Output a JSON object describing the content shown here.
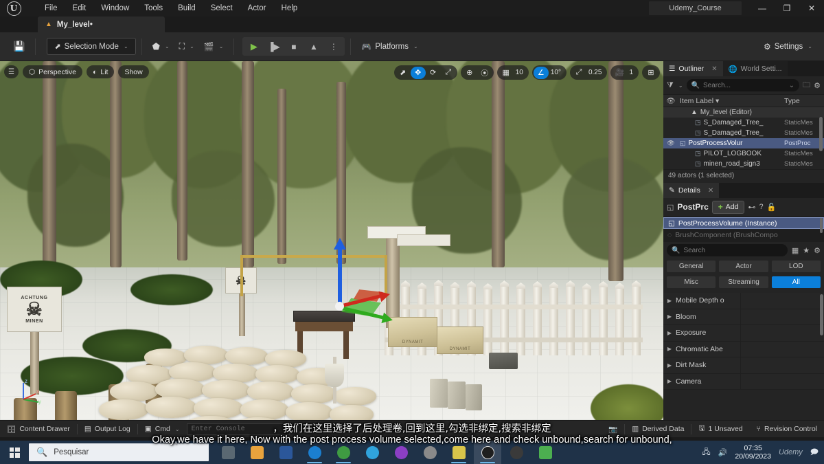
{
  "window": {
    "title": "Udemy_Course",
    "logo_text": "U",
    "minimize": "—",
    "maximize": "❐",
    "close": "✕"
  },
  "menubar": {
    "items": [
      "File",
      "Edit",
      "Window",
      "Tools",
      "Build",
      "Select",
      "Actor",
      "Help"
    ]
  },
  "level_tab": {
    "label": "My_level•",
    "icon": "level-icon"
  },
  "toolbar": {
    "save_icon": "save-icon",
    "selection_mode": "Selection Mode",
    "add_actor_icon": "add-actor-icon",
    "blueprints_icon": "blueprints-icon",
    "cinematics_icon": "cinematics-icon",
    "play": "▶",
    "skip": "▐▶",
    "stop": "■",
    "eject": "▲",
    "more": "⋮",
    "platforms": "Platforms",
    "settings": "Settings",
    "caret": "⌄"
  },
  "viewport": {
    "menu_icon": "viewport-menu-icon",
    "perspective": "Perspective",
    "lit": "Lit",
    "show": "Show",
    "tools": {
      "select": "select-tool-icon",
      "translate": "translate-tool-icon",
      "rotate": "rotate-tool-icon",
      "scale": "scale-tool-icon",
      "world_coord": "world-coordinate-icon",
      "surface_snap": "surface-snap-icon",
      "grid_snap": "grid-snap-icon",
      "grid_value": "10",
      "angle_snap": "angle-snap-icon",
      "angle_value": "10°",
      "scale_snap": "scale-snap-icon",
      "scale_value": "0.25",
      "camera_speed": "camera-speed-icon",
      "camera_value": "1",
      "layouts": "viewport-layouts-icon"
    },
    "axis": {
      "x": "x",
      "y": "y",
      "z": "z"
    },
    "scene": {
      "sign_line1": "ACHTUNG",
      "sign_line2": "MINEN",
      "crate_label": "DYNAMIT"
    }
  },
  "outliner": {
    "tab_label": "Outliner",
    "tab_icon": "outliner-icon",
    "world_settings_tab": "World Setti...",
    "world_settings_icon": "world-icon",
    "close": "✕",
    "filter_icon": "filter-icon",
    "search_placeholder": "Search...",
    "search_value": "",
    "new_folder_icon": "new-folder-icon",
    "settings_icon": "gear-icon",
    "columns": {
      "eye": "eye-icon",
      "label": "Item Label",
      "sort": "▾",
      "type": "Type"
    },
    "rows": [
      {
        "name": "My_level (Editor)",
        "type": "",
        "icon": "level-icon",
        "selected": false,
        "is_root": true
      },
      {
        "name": "S_Damaged_Tree_",
        "type": "StaticMes",
        "icon": "mesh-icon",
        "selected": false
      },
      {
        "name": "S_Damaged_Tree_",
        "type": "StaticMes",
        "icon": "mesh-icon",
        "selected": false
      },
      {
        "name": "PostProcessVolur",
        "type": "PostProc",
        "icon": "volume-icon",
        "selected": true
      },
      {
        "name": "PILOT_LOGBOOK",
        "type": "StaticMes",
        "icon": "mesh-icon",
        "selected": false
      },
      {
        "name": "minen_road_sign3",
        "type": "StaticMes",
        "icon": "mesh-icon",
        "selected": false
      }
    ],
    "status": "49 actors (1 selected)"
  },
  "details": {
    "tab_label": "Details",
    "tab_icon": "details-icon",
    "close": "✕",
    "object_name": "PostPrc",
    "object_icon": "volume-icon",
    "add_label": "Add",
    "add_plus": "+",
    "blueprint_icon": "blueprint-icon",
    "help_icon": "help-icon",
    "lock_icon": "lock-icon",
    "components": [
      {
        "label": "PostProcessVolume (Instance)",
        "icon": "volume-icon",
        "selected": true
      },
      {
        "label": "BrushComponent (BrushCompo",
        "icon": "brush-icon",
        "selected": false
      }
    ],
    "search_placeholder": "Search",
    "search_value": "",
    "grid_view_icon": "grid-view-icon",
    "favorites_icon": "star-icon",
    "settings_icon": "gear-icon",
    "filters": [
      {
        "label": "General",
        "active": false
      },
      {
        "label": "Actor",
        "active": false
      },
      {
        "label": "LOD",
        "active": false
      },
      {
        "label": "Misc",
        "active": false
      },
      {
        "label": "Streaming",
        "active": false
      },
      {
        "label": "All",
        "active": true
      }
    ],
    "properties": [
      {
        "label": "Mobile Depth o",
        "arrow": "▶"
      },
      {
        "label": "Bloom",
        "arrow": "▶"
      },
      {
        "label": "Exposure",
        "arrow": "▶"
      },
      {
        "label": "Chromatic Abe",
        "arrow": "▶"
      },
      {
        "label": "Dirt Mask",
        "arrow": "▶"
      },
      {
        "label": "Camera",
        "arrow": "▶"
      }
    ]
  },
  "statusbar": {
    "content_drawer": "Content Drawer",
    "content_drawer_icon": "drawer-icon",
    "output_log": "Output Log",
    "output_log_icon": "log-icon",
    "cmd": "Cmd",
    "cmd_icon": "cmd-icon",
    "console_placeholder": "Enter Console",
    "console_value": "",
    "screenshot_icon": "camera-icon",
    "derived_data": "Derived Data",
    "derived_data_icon": "database-icon",
    "unsaved": "1 Unsaved",
    "unsaved_icon": "save-star-icon",
    "revision_control": "Revision Control",
    "revision_control_icon": "branch-icon"
  },
  "subtitles": {
    "chinese": "，我们在这里选择了后处理卷,回到这里,勾选非绑定,搜索非绑定",
    "english": "Okay,we have it here, Now with the post process volume selected,come here and check unbound,search for unbound,"
  },
  "taskbar": {
    "start_icon": "windows-start-icon",
    "search_placeholder": "Pesquisar",
    "search_icon": "search-icon",
    "apps": [
      {
        "name": "task-view-icon",
        "color": "#5a6872",
        "active": false
      },
      {
        "name": "explorer-icon",
        "color": "#e8a33d",
        "active": false
      },
      {
        "name": "word-icon",
        "color": "#2b579a",
        "active": false
      },
      {
        "name": "edge-icon",
        "color": "#1b7fd0",
        "active": false
      },
      {
        "name": "chrome-icon",
        "color": "#3f9b42",
        "active": false
      },
      {
        "name": "telegram-icon",
        "color": "#30a3dc",
        "active": false
      },
      {
        "name": "app-purple-icon",
        "color": "#8b3fc4",
        "active": false
      },
      {
        "name": "app-gray-icon",
        "color": "#8a8a8a",
        "active": false
      },
      {
        "name": "photos-icon",
        "color": "#d8c44a",
        "active": false
      },
      {
        "name": "unreal-icon",
        "color": "#1f1f1f",
        "active": true
      },
      {
        "name": "app-dark-icon",
        "color": "#3a3a3a",
        "active": false
      },
      {
        "name": "app-green-icon",
        "color": "#4caf50",
        "active": false
      }
    ],
    "tray": {
      "network_icon": "network-icon",
      "volume_icon": "volume-icon",
      "time": "07:35",
      "date": "20/09/2023",
      "watermark": "Udemy",
      "notifications_icon": "notifications-icon"
    }
  }
}
